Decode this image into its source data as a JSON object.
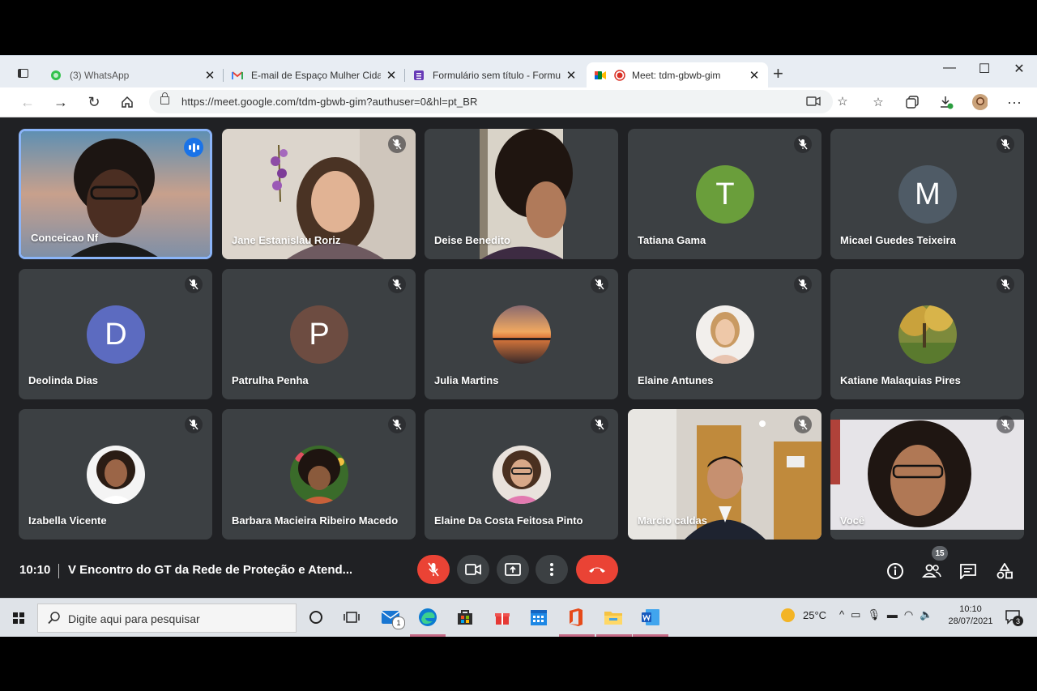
{
  "browser": {
    "tabs": [
      {
        "title": "(3) WhatsApp",
        "icon": "whatsapp-icon",
        "active": false
      },
      {
        "title": "E-mail de Espaço Mulher Cidadã",
        "icon": "gmail-icon",
        "active": false
      },
      {
        "title": "Formulário sem título - Formulár",
        "icon": "forms-icon",
        "active": false
      },
      {
        "title": "Meet: tdm-gbwb-gim",
        "icon": "meet-icon",
        "active": true
      }
    ],
    "url": "https://meet.google.com/tdm-gbwb-gim?authuser=0&hl=pt_BR"
  },
  "participants": [
    {
      "name": "Conceicao Nf",
      "speaking": true
    },
    {
      "name": "Jane Estanislau Roriz",
      "muted": true
    },
    {
      "name": "Deise Benedito"
    },
    {
      "name": "Tatiana Gama",
      "initial": "T",
      "color": "#6a9e3b",
      "muted": true
    },
    {
      "name": "Micael Guedes Teixeira",
      "initial": "M",
      "color": "#4f5b66",
      "muted": true
    },
    {
      "name": "Deolinda Dias",
      "initial": "D",
      "color": "#5c6bc0",
      "muted": true
    },
    {
      "name": "Patrulha Penha",
      "initial": "P",
      "color": "#6d4c41",
      "muted": true
    },
    {
      "name": "Julia Martins",
      "muted": true
    },
    {
      "name": "Elaine Antunes",
      "muted": true
    },
    {
      "name": "Katiane Malaquias Pires",
      "muted": true
    },
    {
      "name": "Izabella Vicente",
      "muted": true
    },
    {
      "name": "Barbara Macieira Ribeiro Macedo",
      "muted": true
    },
    {
      "name": "Elaine Da Costa Feitosa Pinto",
      "muted": true
    },
    {
      "name": "Marcio caldas",
      "muted": true
    },
    {
      "name": "Você",
      "muted": true
    }
  ],
  "meeting": {
    "time": "10:10",
    "title": "V Encontro do GT da Rede de Proteção e Atend...",
    "participant_count": "15"
  },
  "taskbar": {
    "search_placeholder": "Digite aqui para pesquisar",
    "temperature": "25°C",
    "time": "10:10",
    "date": "28/07/2021",
    "mail_badge": "1",
    "notification_count": "3"
  }
}
